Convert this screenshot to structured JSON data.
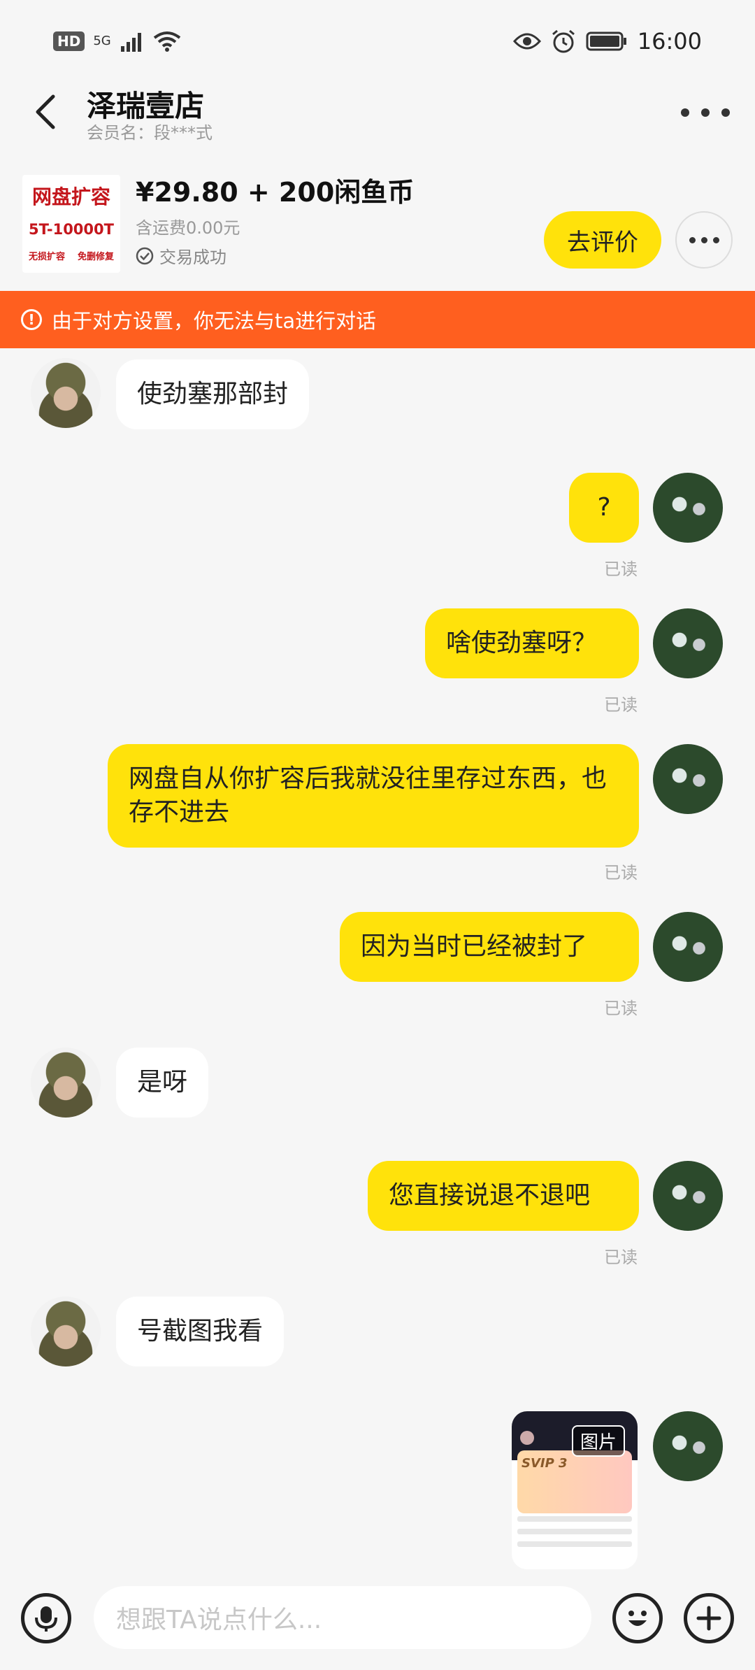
{
  "status_bar": {
    "hd": "HD",
    "network": "5G",
    "time": "16:00"
  },
  "header": {
    "shop_name": "泽瑞壹店",
    "member": "会员名：段***式"
  },
  "product": {
    "img_line1": "网盘扩容",
    "img_line2": "5T-10000T",
    "img_line3a": "无损扩容",
    "img_line3b": "免删修复",
    "price": "¥29.80 + 200闲鱼币",
    "shipping": "含运费0.00元",
    "status": "交易成功",
    "review_label": "去评价"
  },
  "warning": {
    "text": "由于对方设置，你无法与ta进行对话"
  },
  "messages": [
    {
      "side": "in",
      "text": "使劲塞那部封"
    },
    {
      "side": "out",
      "text": "?",
      "read": "已读"
    },
    {
      "side": "out",
      "text": "啥使劲塞呀？",
      "read": "已读"
    },
    {
      "side": "out",
      "text": "网盘自从你扩容后我就没往里存过东西，也存不进去",
      "read": "已读"
    },
    {
      "side": "out",
      "text": "因为当时已经被封了",
      "read": "已读"
    },
    {
      "side": "in",
      "text": "是呀"
    },
    {
      "side": "out",
      "text": "您直接说退不退吧",
      "read": "已读"
    },
    {
      "side": "in",
      "text": "号截图我看"
    },
    {
      "side": "out",
      "type": "image",
      "label": "图片",
      "card_text": "SVIP 3"
    }
  ],
  "input": {
    "placeholder": "想跟TA说点什么..."
  },
  "colors": {
    "accent": "#ffe20b",
    "warning": "#ff5f1f",
    "background": "#f6f6f6"
  }
}
